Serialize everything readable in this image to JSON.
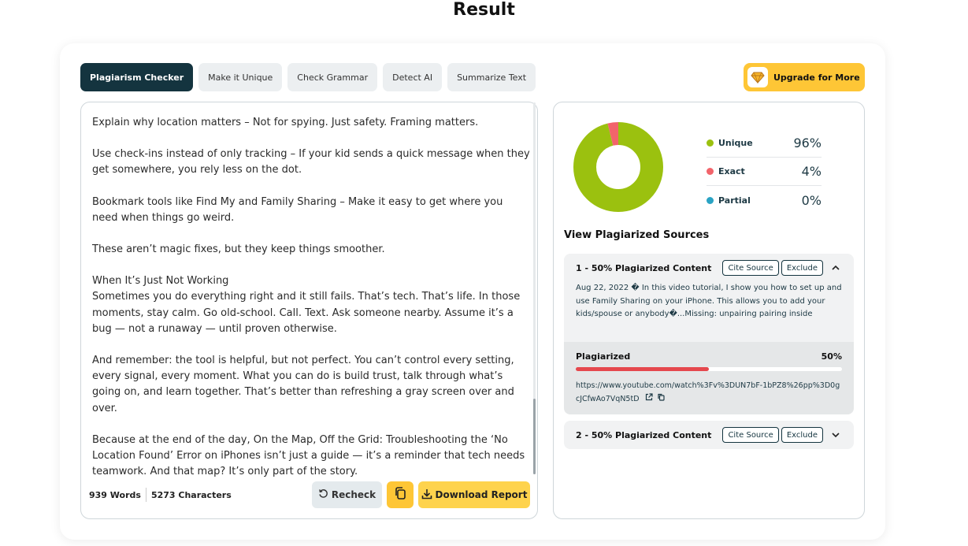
{
  "page": {
    "title": "Result"
  },
  "tabs": [
    {
      "label": "Plagiarism Checker",
      "active": true
    },
    {
      "label": "Make it Unique"
    },
    {
      "label": "Check Grammar"
    },
    {
      "label": "Detect AI"
    },
    {
      "label": "Summarize Text"
    }
  ],
  "upgrade": {
    "label": "Upgrade for More",
    "icon": "diamond-icon"
  },
  "editor": {
    "paragraphs": [
      "Explain why location matters – Not for spying. Just safety. Framing matters.",
      "Use check-ins instead of only tracking – If your kid sends a quick message when they get somewhere, you rely less on the dot.",
      "Bookmark tools like Find My and Family Sharing – Make it easy to get where you need when things go weird.",
      "These aren’t magic fixes, but they keep things smoother.",
      "When It’s Just Not Working",
      "Sometimes you do everything right and it still fails. That’s tech. That’s life. In those moments, stay calm. Go old-school. Call. Text. Ask someone nearby. Assume it’s a bug — not a runaway — until proven otherwise.",
      "And remember: the tool is helpful, but not perfect. You can’t control every setting, every signal, every moment. What you can do is build trust, talk through what’s going on, and learn together. That’s better than refreshing a gray screen over and over.",
      "Because at the end of the day, On the Map, Off the Grid: Troubleshooting the ‘No Location Found’ Error on iPhones isn’t just a guide — it’s a reminder that tech needs teamwork. And that map? It’s only part of the story."
    ],
    "words": "939 Words",
    "characters": "5273 Characters",
    "recheck_label": "Recheck",
    "download_label": "Download Report"
  },
  "summary": {
    "items": [
      {
        "label": "Unique",
        "value": "96%",
        "color": "#9bc10f"
      },
      {
        "label": "Exact",
        "value": "4%",
        "color": "#f2646b"
      },
      {
        "label": "Partial",
        "value": "0%",
        "color": "#2aa3c4"
      }
    ]
  },
  "chart_data": {
    "type": "pie",
    "categories": [
      "Unique",
      "Exact",
      "Partial"
    ],
    "values": [
      96,
      4,
      0
    ],
    "colors": [
      "#9bc10f",
      "#f2646b",
      "#2aa3c4"
    ]
  },
  "sources": {
    "title": "View Plagiarized Sources",
    "cite_label": "Cite Source",
    "exclude_label": "Exclude",
    "items": [
      {
        "title": "1 - 50% Plagiarized Content",
        "expanded": true,
        "snippet": "Aug 22, 2022 � In this video tutorial, I show you how to set up and use Family Sharing on your iPhone. This allows you to add your kids/spouse or anybody�...Missing: unpairing pairing inside",
        "plag_label": "Plagiarized",
        "plag_value": "50%",
        "plag_fraction": 0.5,
        "url": "https://www.youtube.com/watch%3Fv%3DUN7bF-1bPZ8%26pp%3D0gcJCfwAo7VqN5tD"
      },
      {
        "title": "2 - 50% Plagiarized Content",
        "expanded": false
      }
    ]
  }
}
